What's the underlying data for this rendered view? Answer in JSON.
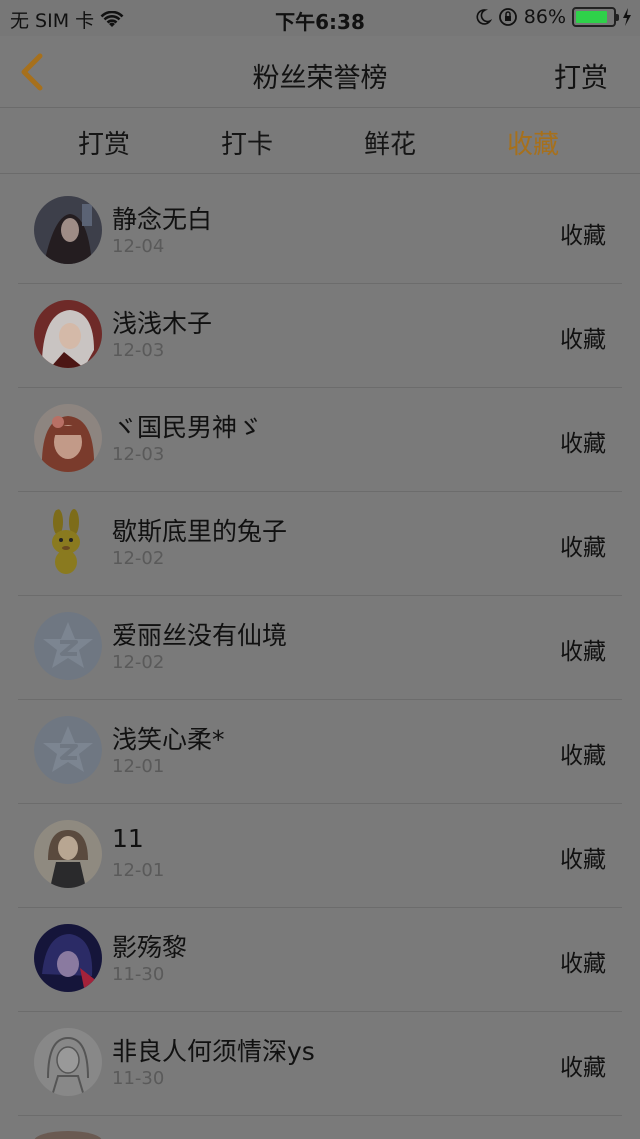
{
  "status_bar": {
    "carrier": "无 SIM 卡",
    "time": "下午6:38",
    "battery_percent": "86%",
    "battery_level": 0.86,
    "battery_color": "#2fd14a"
  },
  "nav": {
    "title": "粉丝荣誉榜",
    "right_label": "打赏"
  },
  "tabs": [
    {
      "label": "打赏",
      "active": false
    },
    {
      "label": "打卡",
      "active": false
    },
    {
      "label": "鲜花",
      "active": false
    },
    {
      "label": "收藏",
      "active": true
    }
  ],
  "accent_color": "#a6701c",
  "fans": [
    {
      "name": "静念无白",
      "date": "12-04",
      "action": "收藏",
      "avatar": "anime-girl-avatar"
    },
    {
      "name": "浅浅木子",
      "date": "12-03",
      "action": "收藏",
      "avatar": "white-hair-avatar"
    },
    {
      "name": "ヾ国民男神ゞ",
      "date": "12-03",
      "action": "收藏",
      "avatar": "girl-photo-avatar"
    },
    {
      "name": "歇斯底里的兔子",
      "date": "12-02",
      "action": "收藏",
      "avatar": "yellow-rabbit-avatar"
    },
    {
      "name": "爱丽丝没有仙境",
      "date": "12-02",
      "action": "收藏",
      "avatar": "default-star-avatar"
    },
    {
      "name": "浅笑心柔*",
      "date": "12-01",
      "action": "收藏",
      "avatar": "default-star-avatar"
    },
    {
      "name": "11",
      "date": "12-01",
      "action": "收藏",
      "avatar": "anime-dark-dress-avatar"
    },
    {
      "name": "影殇黎",
      "date": "11-30",
      "action": "收藏",
      "avatar": "dark-anime-avatar"
    },
    {
      "name": "非良人何须情深ys",
      "date": "11-30",
      "action": "收藏",
      "avatar": "sketch-girl-avatar"
    }
  ]
}
